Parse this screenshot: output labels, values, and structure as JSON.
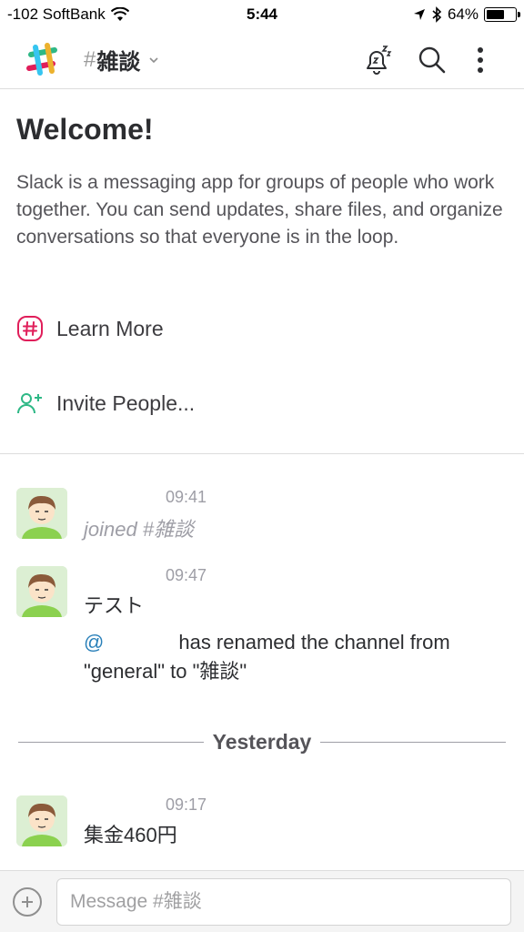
{
  "status_bar": {
    "carrier": "-102 SoftBank",
    "time": "5:44",
    "battery": "64%",
    "battery_level": 0.64
  },
  "header": {
    "channel_hash": "#",
    "channel_name": "雑談"
  },
  "welcome": {
    "title": "Welcome!",
    "description": "Slack is a messaging app for groups of people who work together. You can send updates, share files, and organize conversations so that everyone is in the loop.",
    "learn_more": "Learn More",
    "invite_people": "Invite People..."
  },
  "messages": [
    {
      "time": "09:41",
      "text": "joined #雑談"
    },
    {
      "time": "09:47",
      "text": "テスト"
    }
  ],
  "rename_notice": {
    "mention": "@",
    "text": "has renamed the channel from \"general\" to \"雑談\""
  },
  "date_divider": "Yesterday",
  "last_message": {
    "time": "09:17",
    "text": "集金460円"
  },
  "composer": {
    "placeholder": "Message #雑談"
  },
  "colors": {
    "accent_green": "#2eb886",
    "learn_more_red": "#e01e5a",
    "mention_blue": "#2a80b9"
  }
}
